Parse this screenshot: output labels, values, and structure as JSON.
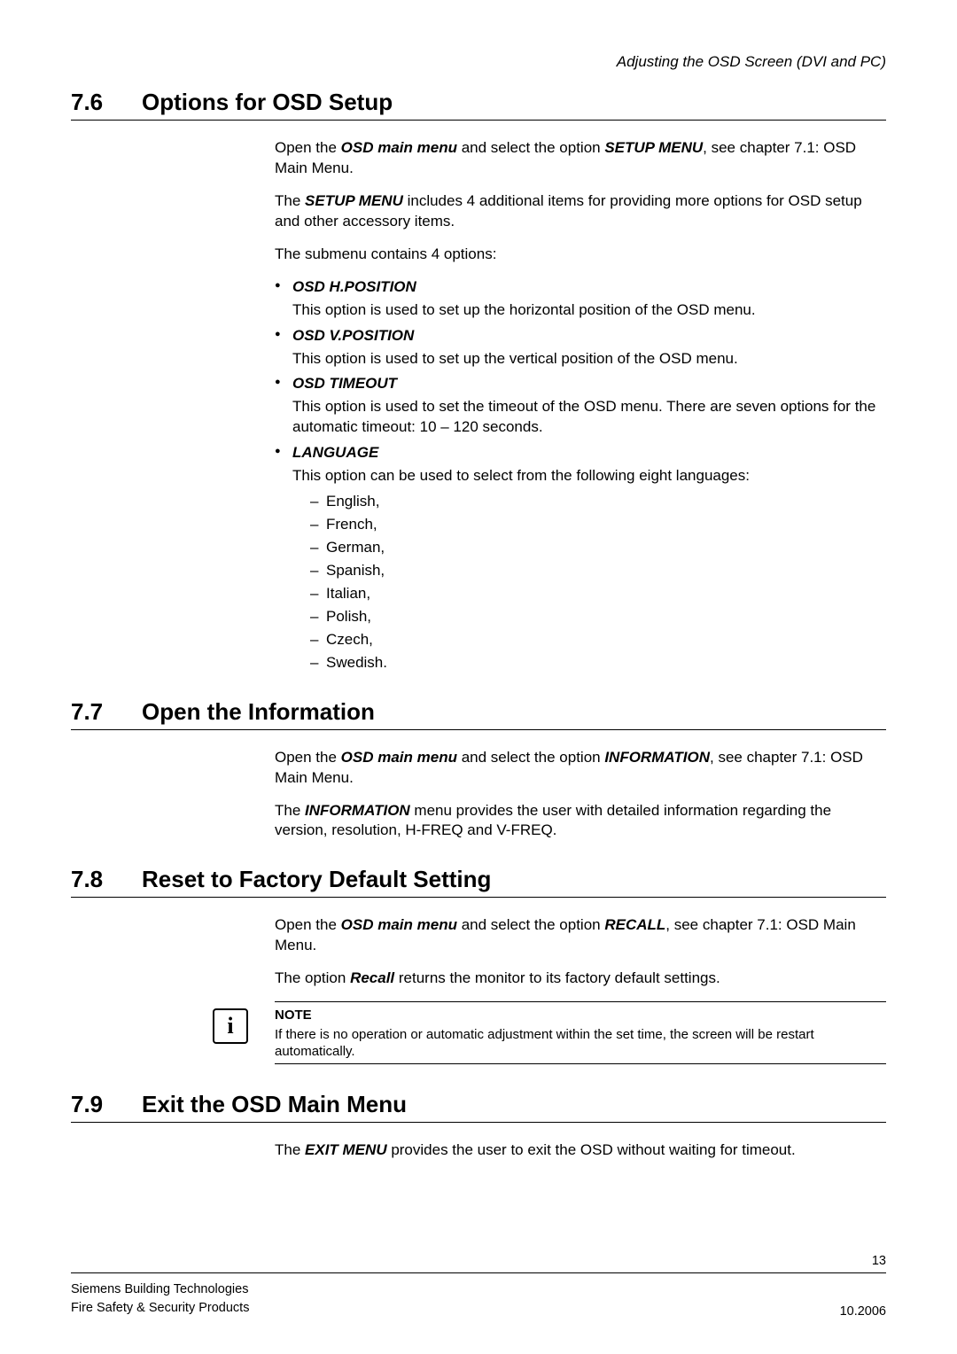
{
  "header": {
    "right": "Adjusting the OSD Screen (DVI and PC)"
  },
  "sections": {
    "s76": {
      "number": "7.6",
      "title": "Options for OSD Setup",
      "p1_pre": "Open the ",
      "p1_b1": "OSD main menu",
      "p1_mid": " and select the option ",
      "p1_b2": "SETUP MENU",
      "p1_post": ", see chapter 7.1: OSD Main Menu.",
      "p2_pre": "The ",
      "p2_b1": "SETUP MENU",
      "p2_post": " includes 4 additional items for providing more options for OSD setup and other accessory items.",
      "p3": "The submenu contains 4 options:",
      "opt1_title": "OSD H.POSITION",
      "opt1_desc": "This option is used to set up the horizontal position of the OSD menu.",
      "opt2_title": "OSD V.POSITION",
      "opt2_desc": "This option is used to set up the vertical position of the OSD menu.",
      "opt3_title": "OSD TIMEOUT",
      "opt3_desc": "This option is used to set the timeout of the OSD menu. There are seven options for the automatic timeout: 10 – 120 seconds.",
      "opt4_title": "LANGUAGE",
      "opt4_desc": "This option can be used to select from the following eight languages:",
      "langs": [
        "English,",
        "French,",
        "German,",
        "Spanish,",
        "Italian,",
        "Polish,",
        "Czech,",
        "Swedish."
      ]
    },
    "s77": {
      "number": "7.7",
      "title": "Open the Information",
      "p1_pre": "Open the ",
      "p1_b1": "OSD main menu",
      "p1_mid": " and select the option ",
      "p1_b2": "INFORMATION",
      "p1_post": ", see chapter 7.1: OSD Main Menu.",
      "p2_pre": "The ",
      "p2_b1": "INFORMATION",
      "p2_post": " menu provides the user with detailed information regarding the version, resolution, H-FREQ and V-FREQ."
    },
    "s78": {
      "number": "7.8",
      "title": "Reset to Factory Default Setting",
      "p1_pre": "Open the ",
      "p1_b1": "OSD main menu",
      "p1_mid": " and select the option ",
      "p1_b2": "RECALL",
      "p1_post": ", see chapter 7.1: OSD Main Menu.",
      "p2_pre": "The option ",
      "p2_b1": "Recall",
      "p2_post": " returns the monitor to its factory default settings.",
      "note_label": "NOTE",
      "note_text": "If there is no operation or automatic adjustment within the set time, the screen will be restart automatically."
    },
    "s79": {
      "number": "7.9",
      "title": "Exit the OSD Main Menu",
      "p1_pre": "The ",
      "p1_b1": "EXIT MENU",
      "p1_post": " provides the user to exit the OSD without waiting for timeout."
    }
  },
  "footer": {
    "page_number": "13",
    "left_line1": "Siemens Building Technologies",
    "left_line2": "Fire Safety & Security Products",
    "right": "10.2006"
  }
}
